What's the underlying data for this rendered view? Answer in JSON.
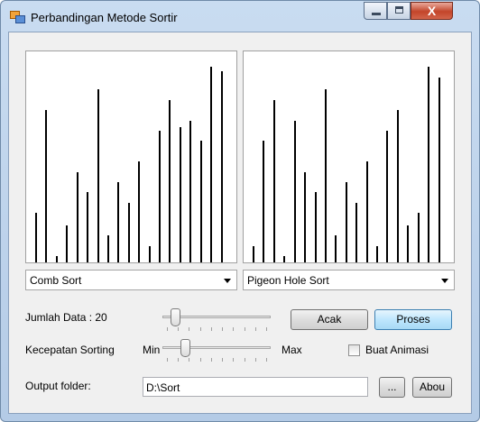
{
  "window": {
    "title": "Perbandingan Metode Sortir"
  },
  "titlebar": {
    "minimize_glyph": "",
    "maximize_glyph": "",
    "close_glyph": "X"
  },
  "left_panel": {
    "bars": [
      0.24,
      0.74,
      0.03,
      0.18,
      0.44,
      0.34,
      0.84,
      0.13,
      0.39,
      0.29,
      0.49,
      0.08,
      0.64,
      0.79,
      0.66,
      0.69,
      0.59,
      0.95,
      0.93
    ],
    "algorithm": "Comb Sort"
  },
  "right_panel": {
    "bars": [
      0.08,
      0.59,
      0.79,
      0.03,
      0.69,
      0.44,
      0.34,
      0.84,
      0.13,
      0.39,
      0.29,
      0.49,
      0.08,
      0.64,
      0.74,
      0.18,
      0.24,
      0.95,
      0.9
    ],
    "algorithm": "Pigeon Hole Sort"
  },
  "controls": {
    "jumlah_label": "Jumlah Data : 20",
    "jumlah_slider_level": 0.08,
    "acak_button": "Acak",
    "proses_button": "Proses",
    "kecepatan_label": "Kecepatan Sorting",
    "min_label": "Min",
    "max_label": "Max",
    "kecepatan_slider_level": 0.18,
    "animasi_label": "Buat Animasi",
    "animasi_checked": false,
    "output_label": "Output folder:",
    "output_value": "D:\\Sort",
    "browse_button": "...",
    "about_button": "Abou"
  }
}
